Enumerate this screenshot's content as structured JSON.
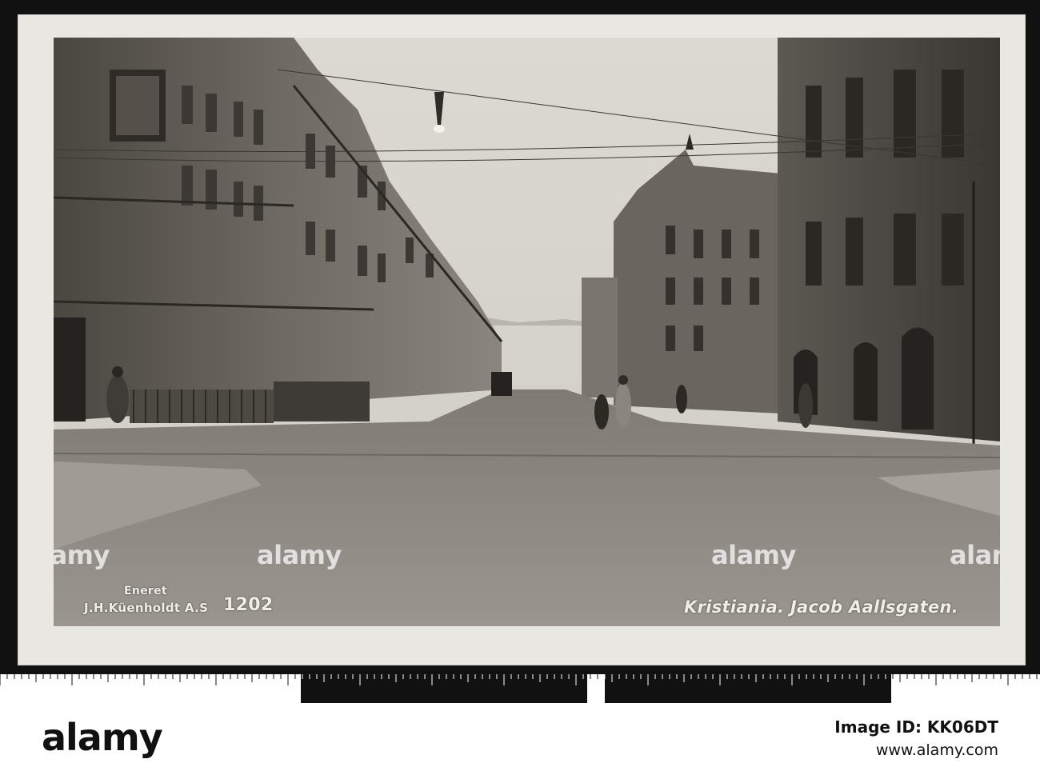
{
  "caption": {
    "publisher_line1": "Eneret",
    "publisher_line2": "J.H.Küenholdt A.S",
    "card_number": "1202",
    "title": "Kristiania.  Jacob Aallsgaten."
  },
  "watermarks": {
    "photo_left": "alamy",
    "photo_center_left": "alamy",
    "photo_center_right": "alamy",
    "photo_right": "alamy"
  },
  "footer": {
    "logo": "alamy",
    "image_id": "Image ID: KK06DT",
    "url": "www.alamy.com"
  },
  "colors": {
    "photo_sepia_light": "#d8d5ce",
    "photo_sepia_dark": "#2e2b27",
    "card_border": "#e9e7e1",
    "background": "#111111"
  }
}
